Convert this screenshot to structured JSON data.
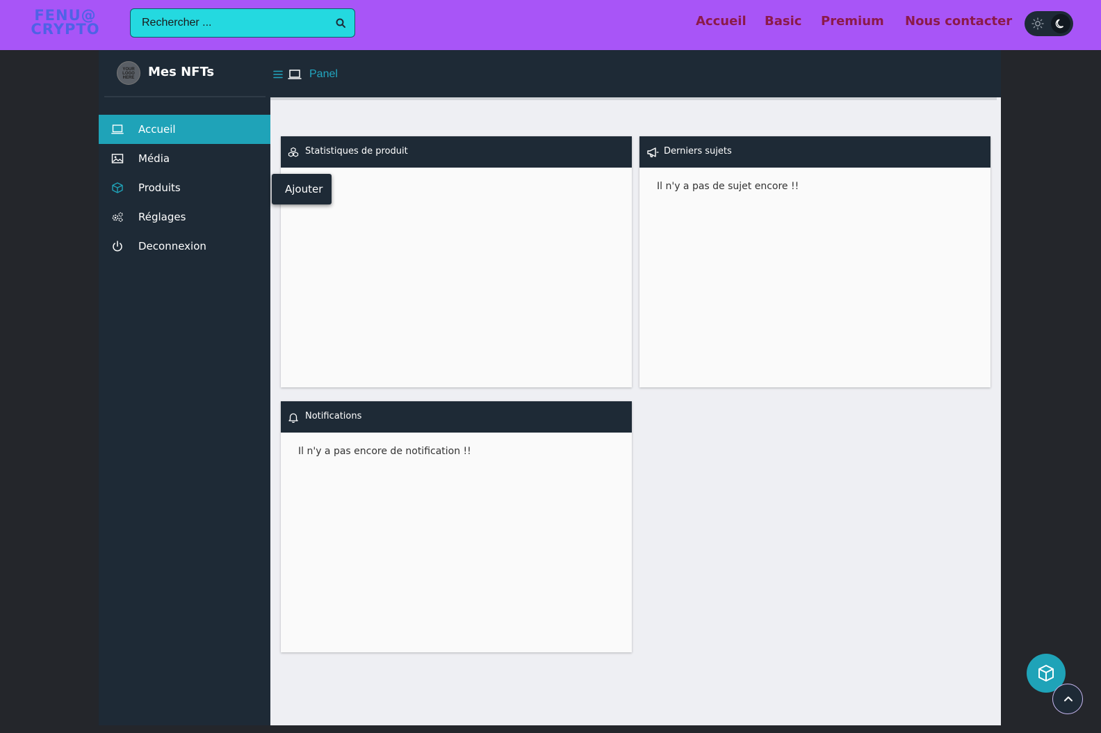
{
  "header": {
    "logo_line1": "FENU@",
    "logo_line2": "CRYPTO",
    "search": {
      "placeholder": "Rechercher ..."
    },
    "nav": [
      {
        "label": "Accueil"
      },
      {
        "label": "Basic"
      },
      {
        "label": "Premium"
      },
      {
        "label": "Nous contacter"
      }
    ],
    "theme_toggle": {
      "current": "dark"
    }
  },
  "brand": {
    "avatar_text": "YOUR LOGO HERE",
    "title": "Mes NFTs"
  },
  "breadcrumb": {
    "label": "Panel"
  },
  "sidebar": {
    "items": [
      {
        "label": "Accueil",
        "icon": "laptop-icon",
        "active": true
      },
      {
        "label": "Média",
        "icon": "image-icon",
        "active": false
      },
      {
        "label": "Produits",
        "icon": "cube-icon",
        "active": false
      },
      {
        "label": "Réglages",
        "icon": "gears-icon",
        "active": false
      },
      {
        "label": "Deconnexion",
        "icon": "power-icon",
        "active": false
      }
    ]
  },
  "tooltip": {
    "label": "Ajouter"
  },
  "cards": {
    "stats": {
      "title": "Statistiques de produit",
      "icon": "cubes-icon"
    },
    "subjects": {
      "title": "Derniers sujets",
      "icon": "megaphone-icon",
      "empty_text": "Il n'y a pas de sujet encore !!"
    },
    "notifications": {
      "title": "Notifications",
      "icon": "bell-icon",
      "empty_text": "Il n'y a pas encore de notification !!"
    }
  },
  "colors": {
    "topbar": "#a855f7",
    "search_bg": "#24d9e0",
    "nav_text": "#8b1a4a",
    "panel_dark": "#1e2a36",
    "accent": "#1fa3b8",
    "page_bg": "#24262b",
    "content_bg": "#eeeff3"
  }
}
